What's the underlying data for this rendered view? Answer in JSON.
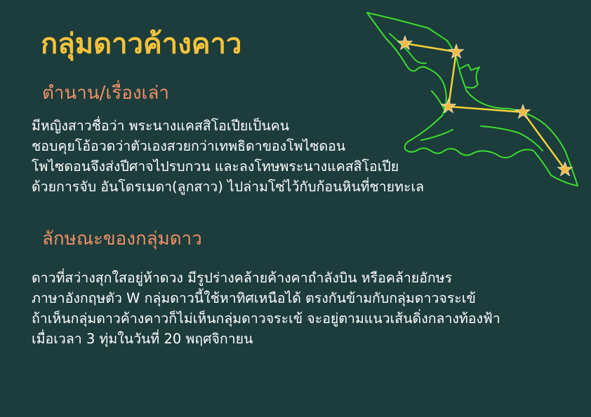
{
  "title": "กลุ่มดาวค้างคาว",
  "legend": {
    "heading": "ตำนาน/เรื่องเล่า",
    "lines": [
      "มีหญิงสาวชื่อว่า พระนางแคสสิโอเปียเป็นคน",
      "ชอบคุยโอ้อวดว่าตัวเองสวยกว่าเทพธิดาของโพไซดอน",
      "โพไซดอนจึงส่งปีศาจไปรบกวน และลงโทษพระนางแคสสิโอเปีย",
      "ด้วยการจับ อันโดรเมดา(ลูกสาว) ไปล่ามโซ่ไว้กับก้อนหินที่ชายทะเล"
    ]
  },
  "features": {
    "heading": "ลักษณะของกลุ่มดาว",
    "lines": [
      "ดาวที่สว่างสุกใสอยู่ห้าดวง มีรูปร่างคล้ายค้างคาถำลังบิน หรือคล้ายอักษร",
      "ภาษาอังกฤษตัว W กลุ่มดาวนี้ใช้หาทิศเหนือได้ ตรงกันข้ามกับกลุ่มดาวจระเข้",
      "ถ้าเห็นกลุ่มดาวค้างคาวก็ไม่เห็นกลุ่มดาวจระเข้ จะอยู่ตามแนวเส้นดิ่งกลางท้องฟ้า",
      "เมื่อเวลา 3 ทุ่มในวันที่ 20 พฤศจิกายน"
    ]
  },
  "illustration": {
    "icon": "bat-constellation-icon",
    "star_count": 5,
    "colors": {
      "background": "#1c3d3b",
      "title": "#f5c23a",
      "heading": "#f0906a",
      "bat_outline": "#3ddc2f",
      "star_line": "#f2d23a",
      "star": "#f5b942"
    }
  }
}
